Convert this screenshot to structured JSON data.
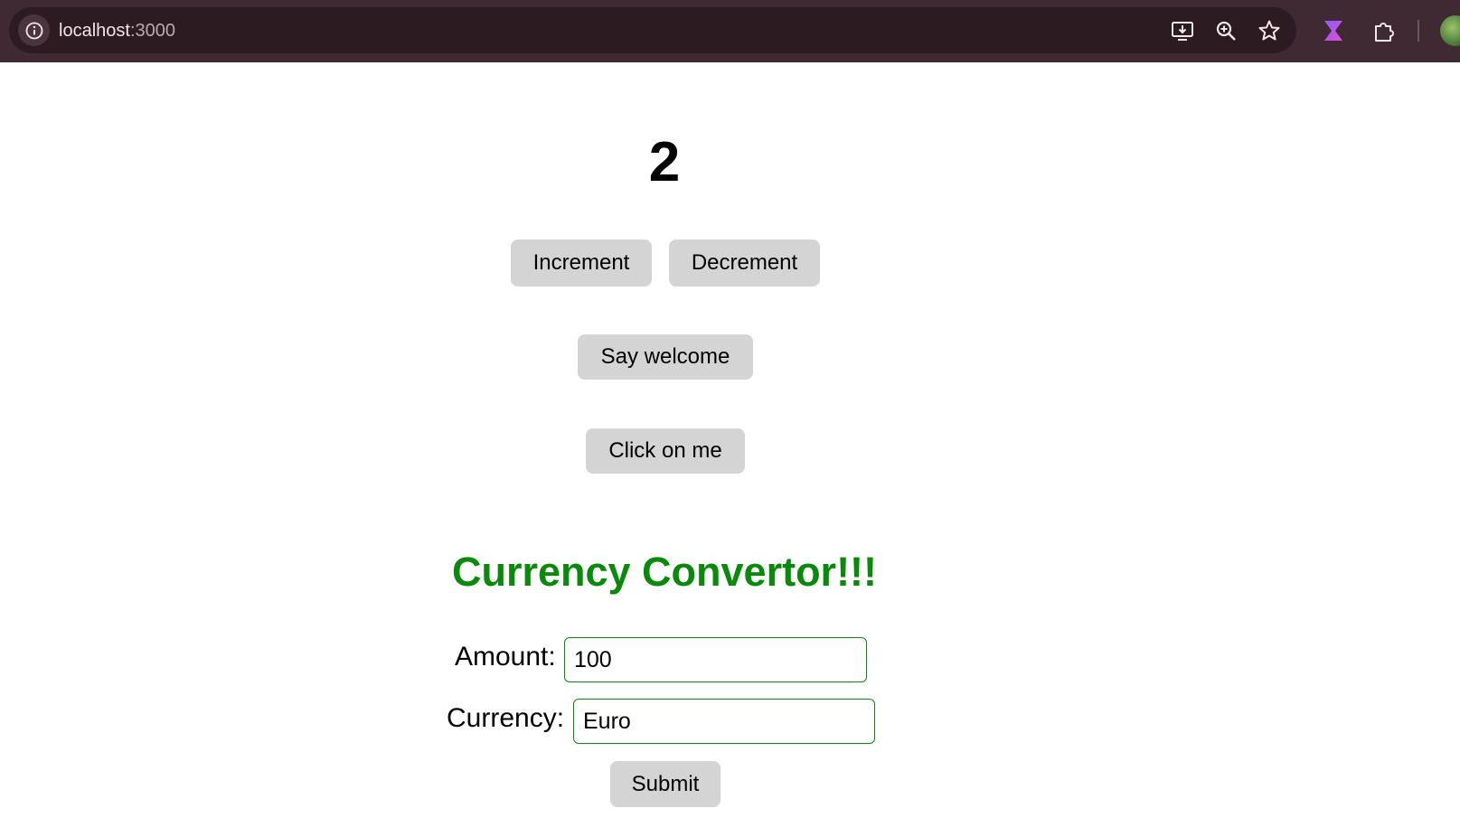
{
  "browser": {
    "url_host": "localhost",
    "url_port": ":3000"
  },
  "counter": {
    "value": "2",
    "increment_label": "Increment",
    "decrement_label": "Decrement"
  },
  "actions": {
    "say_welcome_label": "Say welcome",
    "click_me_label": "Click on me"
  },
  "converter": {
    "title": "Currency Convertor!!!",
    "amount_label": "Amount:",
    "amount_value": "100",
    "currency_label": "Currency:",
    "currency_value": "Euro",
    "submit_label": "Submit"
  },
  "colors": {
    "accent_green": "#0a8a0a",
    "button_gray": "#d4d4d4",
    "browser_frame": "#3f2a33"
  },
  "icons": {
    "omnibox": [
      "info-icon",
      "install-app-icon",
      "zoom-icon",
      "bookmark-star-icon"
    ],
    "toolbar": [
      "extension-hourglass-icon",
      "extensions-puzzle-icon",
      "profile-avatar"
    ]
  }
}
